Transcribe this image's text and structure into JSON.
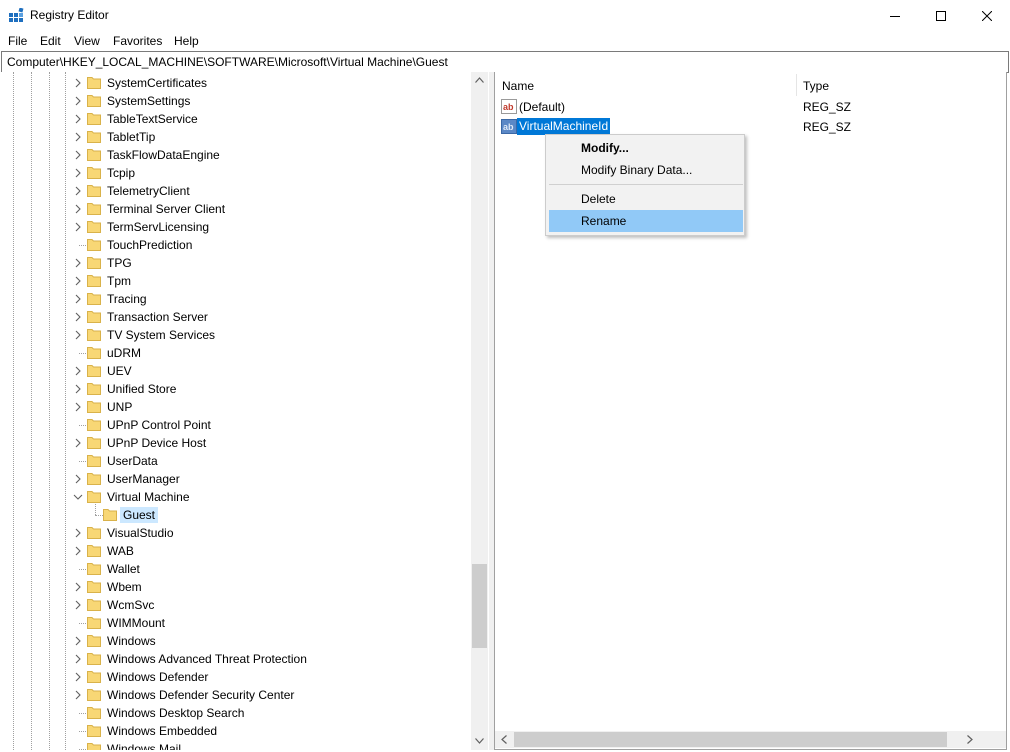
{
  "window": {
    "title": "Registry Editor"
  },
  "menu": [
    "File",
    "Edit",
    "View",
    "Favorites",
    "Help"
  ],
  "address": "Computer\\HKEY_LOCAL_MACHINE\\SOFTWARE\\Microsoft\\Virtual Machine\\Guest",
  "tree": {
    "items": [
      "SystemCertificates",
      "SystemSettings",
      "TableTextService",
      "TabletTip",
      "TaskFlowDataEngine",
      "Tcpip",
      "TelemetryClient",
      "Terminal Server Client",
      "TermServLicensing",
      "TouchPrediction",
      "TPG",
      "Tpm",
      "Tracing",
      "Transaction Server",
      "TV System Services",
      "uDRM",
      "UEV",
      "Unified Store",
      "UNP",
      "UPnP Control Point",
      "UPnP Device Host",
      "UserData",
      "UserManager",
      "Virtual Machine",
      "Guest",
      "VisualStudio",
      "WAB",
      "Wallet",
      "Wbem",
      "WcmSvc",
      "WIMMount",
      "Windows",
      "Windows Advanced Threat Protection",
      "Windows Defender",
      "Windows Defender Security Center",
      "Windows Desktop Search",
      "Windows Embedded",
      "Windows Mail"
    ]
  },
  "list": {
    "columns": [
      "Name",
      "Type"
    ],
    "rows": [
      {
        "name": "(Default)",
        "type": "REG_SZ"
      },
      {
        "name": "VirtualMachineId",
        "type": "REG_SZ"
      }
    ]
  },
  "context_menu": {
    "items": [
      "Modify...",
      "Modify Binary Data...",
      "Delete",
      "Rename"
    ],
    "highlighted": "Rename"
  },
  "colors": {
    "selection": "#0078d7",
    "menu_highlight": "#91c9f7",
    "folder": "#f8d775",
    "tree_selection": "#cce8ff"
  }
}
